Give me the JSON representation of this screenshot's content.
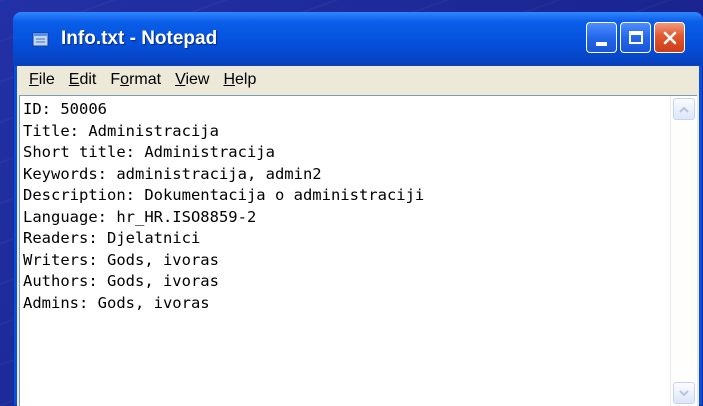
{
  "window": {
    "title": "Info.txt - Notepad",
    "app_icon": "notepad-icon",
    "controls": {
      "minimize": "minimize-icon",
      "maximize": "maximize-icon",
      "close": "close-icon"
    }
  },
  "menu": [
    {
      "pre": "",
      "key": "F",
      "post": "ile"
    },
    {
      "pre": "",
      "key": "E",
      "post": "dit"
    },
    {
      "pre": "F",
      "key": "o",
      "post": "rmat"
    },
    {
      "pre": "",
      "key": "V",
      "post": "iew"
    },
    {
      "pre": "",
      "key": "H",
      "post": "elp"
    }
  ],
  "document": {
    "lines": [
      "ID: 50006",
      "Title: Administracija",
      "Short title: Administracija",
      "Keywords: administracija, admin2",
      "Description: Dokumentacija o administraciji",
      "Language: hr_HR.ISO8859-2",
      "Readers: Djelatnici",
      "Writers: Gods, ivoras",
      "Authors: Gods, ivoras",
      "Admins: Gods, ivoras"
    ]
  },
  "colors": {
    "titlebar": "#0551dd",
    "close_button": "#e2582f",
    "chrome": "#ece9d8"
  }
}
